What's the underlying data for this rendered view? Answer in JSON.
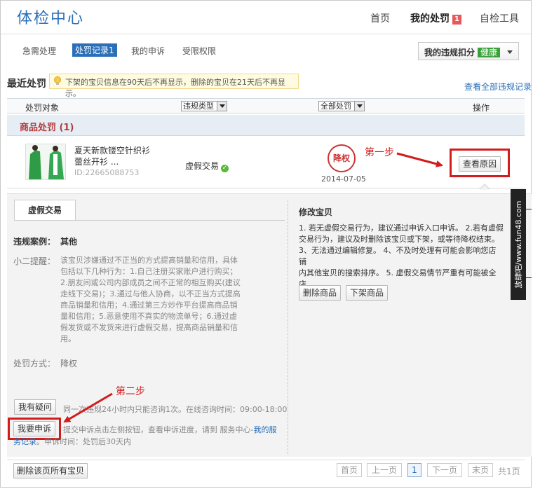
{
  "header": {
    "logo": "体检中心",
    "nav": [
      {
        "label": "首页"
      },
      {
        "label": "我的处罚",
        "badge": "1"
      },
      {
        "label": "自检工具"
      }
    ]
  },
  "tabs": [
    {
      "label": "急需处理"
    },
    {
      "label": "处罚记录1"
    },
    {
      "label": "我的申诉"
    },
    {
      "label": "受限权限"
    }
  ],
  "score": {
    "label": "我的违规扣分",
    "status": "健康"
  },
  "recent": {
    "title": "最近处罚",
    "tip": "下架的宝贝信息在90天后不再显示，删除的宝贝在21天后不再显示。",
    "view_all": "查看全部违规记录"
  },
  "table": {
    "col_object": "处罚对象",
    "col_type": "违规类型",
    "col_all": "全部处罚",
    "col_action": "操作"
  },
  "group_title": "商品处罚 (1)",
  "item": {
    "title_line1": "夏天新款镂空针织衫",
    "title_line2": "蕾丝开衫 ...",
    "id": "ID:22665088753",
    "violation": "虚假交易",
    "stamp": "降权",
    "date": "2014-07-05",
    "view_reason": "查看原因"
  },
  "annotations": {
    "step1": "第一步",
    "step2": "第二步"
  },
  "detail": {
    "tab": "虚假交易",
    "case_label": "违规案例：",
    "case_value": "其他",
    "reminder_label": "小二提醒：",
    "reminder_lines": [
      "该宝贝涉嫌通过不正当的方式提高销量和信用，具体",
      "包括以下几种行为：1.自己注册买家账户进行购买；",
      "2.朋友间或公司内部成员之间不正常的相互购买(建议",
      "走线下交易)；3.通过与他人协商，以不正当方式提高",
      "商品销量和信用；4.通过第三方炒作平台提高商品销",
      "量和信用；5.恶意使用不真实的物流单号；6.通过虚",
      "假发货或不发货来进行虚假交易，提高商品销量和信",
      "用。"
    ],
    "method_label": "处罚方式：",
    "method_value": "降权",
    "help_btn": "我有疑问",
    "help_text": "同一次违规24小时内只能咨询1次。在线咨询时间：09:00-18:00",
    "appeal_btn": "我要申诉",
    "appeal_line1": "提交申诉点击左侧按钮，查看申诉进度，请到 服务中心-",
    "appeal_link1": "我的服",
    "appeal_link2": "务记录",
    "appeal_line2": "。申诉时间：处罚后30天内",
    "fix_title": "修改宝贝",
    "fix_lines": [
      "1. 若无虚假交易行为，建议通过申诉入口申诉。 2.若有虚假",
      "交易行为，建议及时删除该宝贝或下架，或等待降权结束。",
      "3、无法通过编辑修复。 4、不及时处理有可能会影响您店铺",
      "内其他宝贝的搜索排序。 5. 虚假交易情节严重有可能被全店",
      "降权"
    ],
    "delete_btn": "删除商品",
    "offline_btn": "下架商品"
  },
  "watermark": "放肆吧/www.fun48.com",
  "footer": {
    "delete_all": "删除该页所有宝贝",
    "first": "首页",
    "prev": "上一页",
    "current": "1",
    "next": "下一页",
    "last": "末页",
    "total": "共1页"
  },
  "colors": {
    "accent": "#2a6fb8",
    "annotation_red": "#d31c1c",
    "health_green": "#39a03a"
  }
}
